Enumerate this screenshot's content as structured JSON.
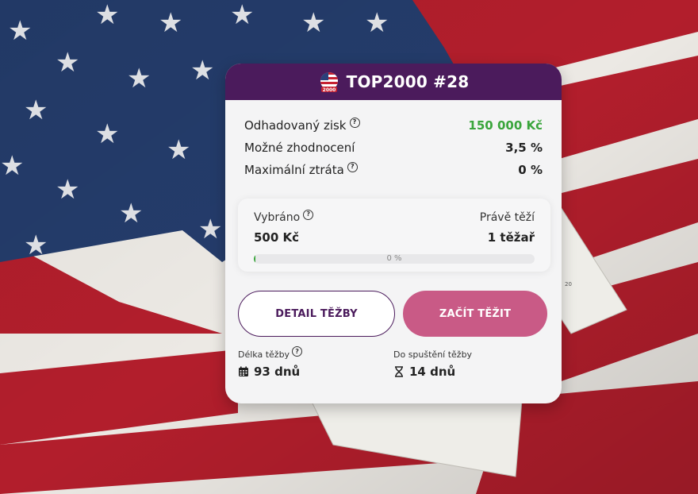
{
  "card": {
    "title": "TOP2000 #28",
    "badge_text": "2000",
    "badge_icon": "us-flag-badge-icon"
  },
  "stats": [
    {
      "label": "Odhadovaný zisk",
      "value": "150 000 Kč",
      "help": true,
      "color": "#3aa53c"
    },
    {
      "label": "Možné zhodnocení",
      "value": "3,5 %",
      "help": false
    },
    {
      "label": "Maximální ztráta",
      "value": "0 %",
      "help": true
    }
  ],
  "progress": {
    "left_label": "Vybráno",
    "left_value": "500 Kč",
    "right_label": "Právě těží",
    "right_value": "1 těžař",
    "percent_text": "0 %",
    "fraction": 0
  },
  "buttons": {
    "detail": "DETAIL TĚŽBY",
    "start": "ZAČÍT TĚŽIT"
  },
  "meta": {
    "duration_label": "Délka těžby",
    "duration_value": "93 dnů",
    "duration_icon": "calendar-icon",
    "start_label": "Do spuštění těžby",
    "start_value": "14 dnů",
    "start_icon": "hourglass-icon"
  },
  "colors": {
    "header": "#4b1b5c",
    "accent_green": "#3aa53c",
    "button_fill": "#c95a86"
  },
  "background": {
    "paper_text": "20"
  }
}
